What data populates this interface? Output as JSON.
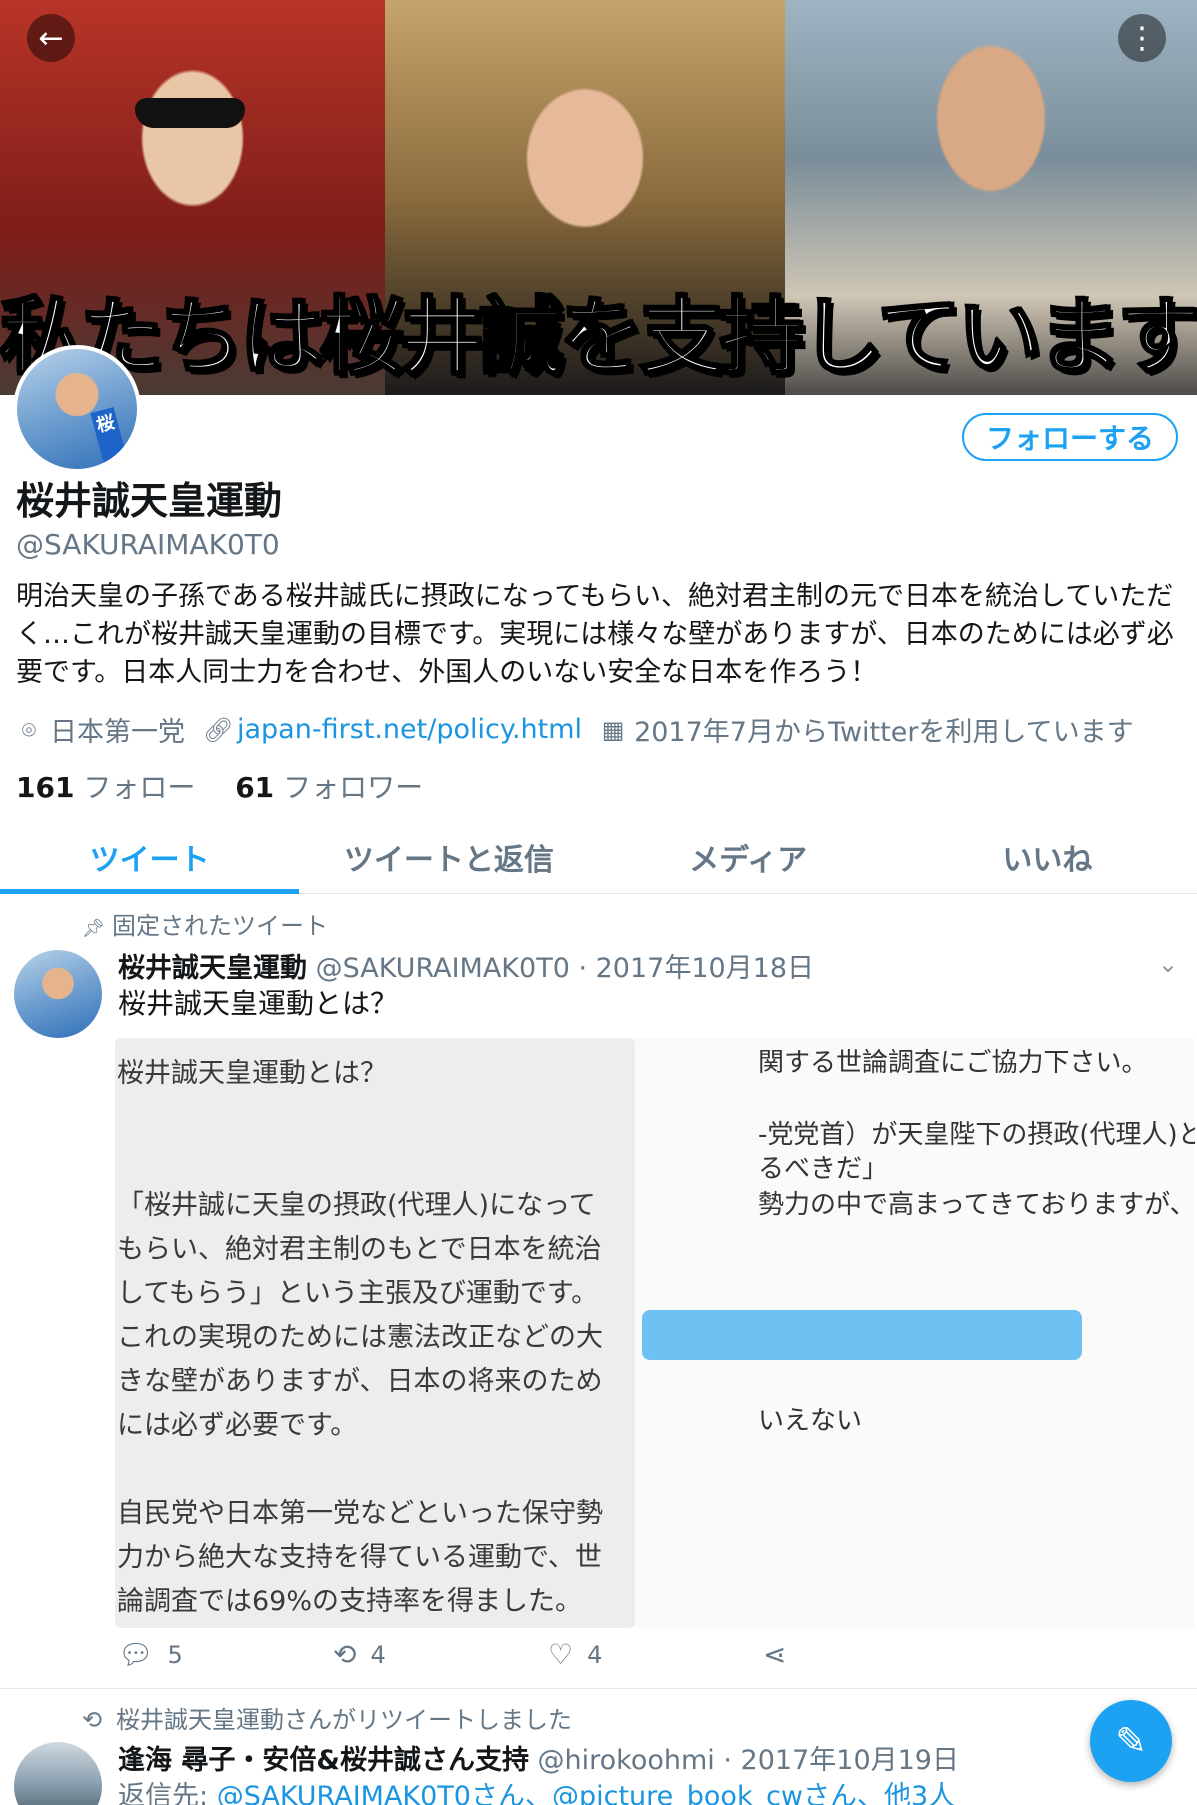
{
  "header": {
    "banner_text": "私たちは桜井誠を支持しています",
    "back_icon": "←",
    "more_icon": "⋮"
  },
  "profile": {
    "avatar_sash": "桜",
    "follow_label": "フォローする",
    "name": "桜井誠天皇運動",
    "handle": "@SAKURAIMAK0T0",
    "bio": "明治天皇の子孫である桜井誠氏に摂政になってもらい、絶対君主制の元で日本を統治していただく…これが桜井誠天皇運動の目標です。実現には様々な壁がありますが、日本のためには必ず必要です。日本人同士力を合わせ、外国人のいない安全な日本を作ろう！",
    "location": "日本第一党",
    "url": "japan-first.net/policy.html",
    "joined": "2017年7月からTwitterを利用しています",
    "following_count": "161",
    "following_label": "フォロー",
    "followers_count": "61",
    "followers_label": "フォロワー"
  },
  "tabs": [
    {
      "label": "ツイート",
      "active": true
    },
    {
      "label": "ツイートと返信",
      "active": false
    },
    {
      "label": "メディア",
      "active": false
    },
    {
      "label": "いいね",
      "active": false
    }
  ],
  "pinned_tweet": {
    "pinned_label": "固定されたツイート",
    "author": "桜井誠天皇運動",
    "handle_date": "@SAKURAIMAK0T0 · 2017年10月18日",
    "text": "桜井誠天皇運動とは？",
    "image_left_text": "桜井誠天皇運動とは？\n\n\n「桜井誠に天皇の摂政(代理人)になって\nもらい、絶対君主制のもとで日本を統治\nしてもらう」という主張及び運動です。\nこれの実現のためには憲法改正などの大\nきな壁がありますが、日本の将来のため\nには必ず必要です。\n\n自民党や日本第一党などといった保守勢\n力から絶大な支持を得ている運動で、世\n論調査では69%の支持率を得ました。",
    "image_right_fragments": {
      "f1": "関する世論調査にご協力下さい。",
      "f2": "-党党首）が天皇陛下の摂政(代理人)とな",
      "f3": "るべきだ」",
      "f4": "勢力の中で高まってきておりますが、賛成",
      "f5": "いえない"
    },
    "replies": "5",
    "retweets": "4",
    "likes": "4"
  },
  "second_tweet": {
    "retweet_label": "桜井誠天皇運動さんがリツイートしました",
    "author": "逢海 尋子・安倍&桜井誠さん支持",
    "handle_date": "@hirokoohmi · 2017年10月19日",
    "reply_prefix": "返信先:",
    "reply_mentions": "@SAKURAIMAK0T0さん、@picture_book_cwさん、他3人"
  },
  "colors": {
    "accent": "#1da1f2",
    "secondary_text": "#657786",
    "link": "#1b95e0"
  }
}
